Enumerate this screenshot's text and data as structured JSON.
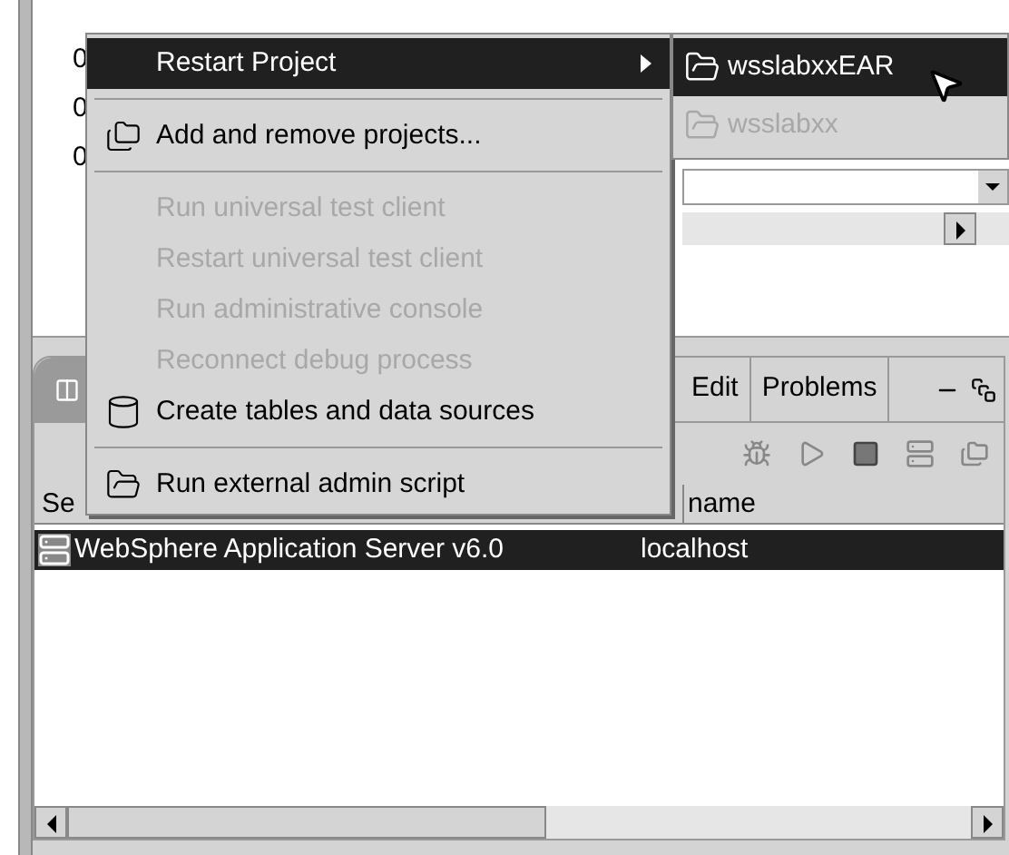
{
  "editor": {
    "line_marks": [
      "0",
      "0",
      "0"
    ]
  },
  "context_menu": {
    "items": [
      {
        "kind": "submenu",
        "label": "Restart Project",
        "selected": true,
        "disabled": false
      },
      {
        "kind": "separator"
      },
      {
        "kind": "projects",
        "label": "Add and remove projects...",
        "selected": false,
        "disabled": false
      },
      {
        "kind": "separator"
      },
      {
        "kind": "item",
        "label": "Run universal test client",
        "selected": false,
        "disabled": true
      },
      {
        "kind": "item",
        "label": "Restart universal test client",
        "selected": false,
        "disabled": true
      },
      {
        "kind": "item",
        "label": "Run administrative console",
        "selected": false,
        "disabled": true
      },
      {
        "kind": "item",
        "label": "Reconnect debug process",
        "selected": false,
        "disabled": true
      },
      {
        "kind": "tables",
        "label": "Create tables and data sources",
        "selected": false,
        "disabled": false
      },
      {
        "kind": "separator"
      },
      {
        "kind": "script",
        "label": "Run external admin script",
        "selected": false,
        "disabled": false
      }
    ]
  },
  "submenu": {
    "items": [
      {
        "label": "wsslabxxEAR",
        "selected": true,
        "disabled": false
      },
      {
        "label": "wsslabxx",
        "selected": false,
        "disabled": true
      }
    ]
  },
  "servers_view": {
    "tabs": [
      {
        "label": "Edit",
        "selected": false
      },
      {
        "label": "Problems",
        "selected": false
      }
    ],
    "columns": [
      "Se",
      "name"
    ],
    "rows": [
      {
        "cells": [
          "WebSphere Application Server v6.0",
          "localhost"
        ],
        "selected": true
      }
    ]
  }
}
